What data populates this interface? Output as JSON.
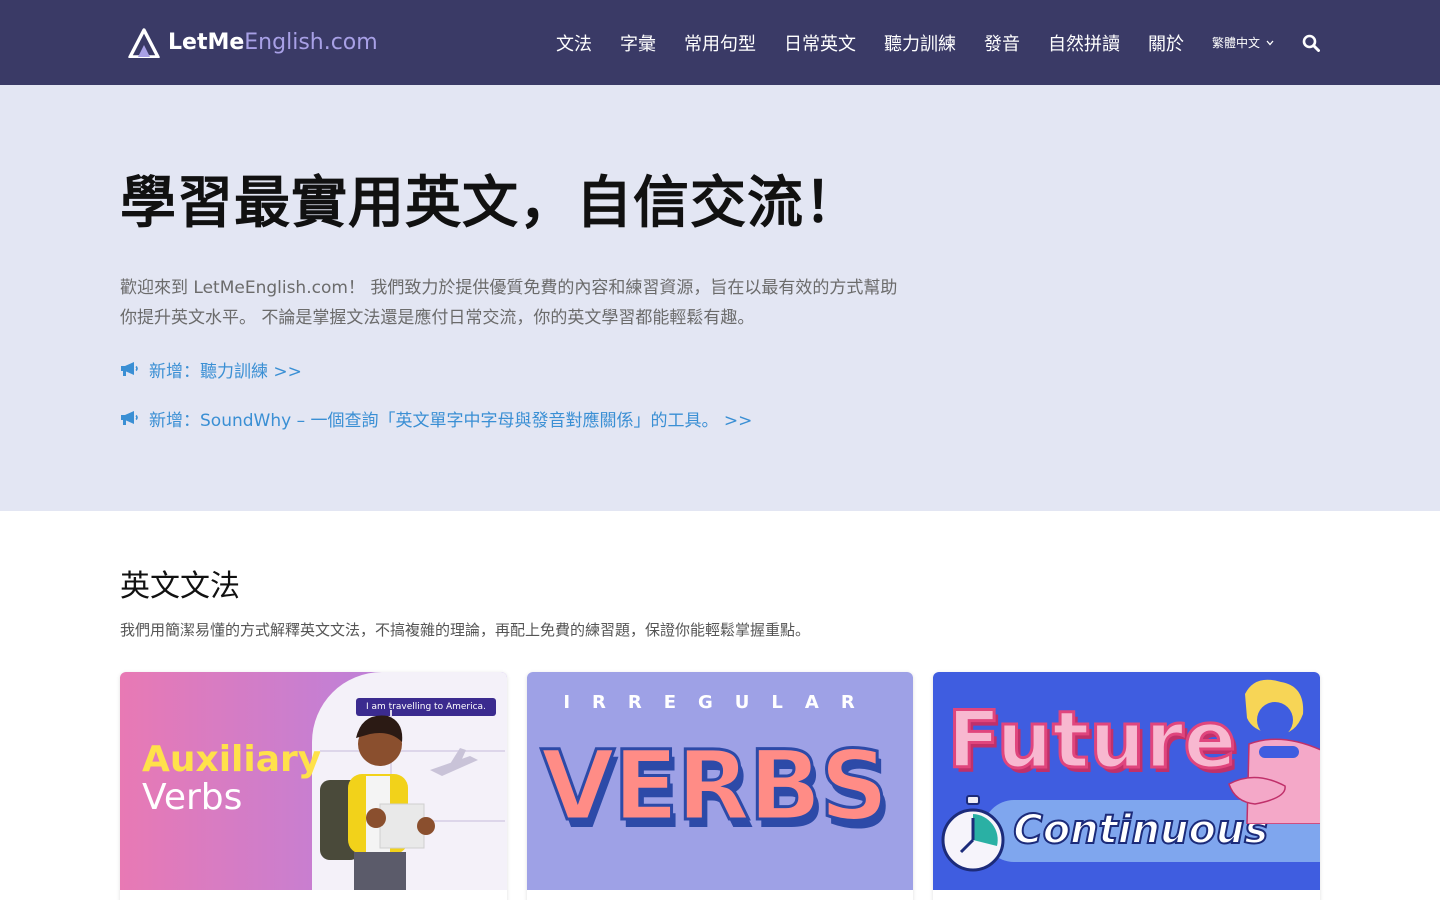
{
  "header": {
    "logo": {
      "part1": "LetMe",
      "part2": "English.com"
    },
    "nav": [
      {
        "label": "文法"
      },
      {
        "label": "字彙"
      },
      {
        "label": "常用句型"
      },
      {
        "label": "日常英文"
      },
      {
        "label": "聽力訓練"
      },
      {
        "label": "發音"
      },
      {
        "label": "自然拼讀"
      },
      {
        "label": "關於"
      }
    ],
    "language": "繁體中文",
    "icons": {
      "search": "search-icon",
      "language_caret": "chevron-down-icon"
    }
  },
  "hero": {
    "title": "學習最實用英文，自信交流！",
    "description": "歡迎來到 LetMeEnglish.com！ 我們致力於提供優質免費的內容和練習資源，旨在以最有效的方式幫助你提升英文水平。 不論是掌握文法還是應付日常交流，你的英文學習都能輕鬆有趣。",
    "announcements": [
      {
        "text": "新增：聽力訓練 >>",
        "icon": "megaphone-icon"
      },
      {
        "text": "新增：SoundWhy – 一個查詢「英文單字中字母與發音對應關係」的工具。 >>",
        "icon": "megaphone-icon"
      }
    ]
  },
  "grammar": {
    "title": "英文文法",
    "subtitle": "我們用簡潔易懂的方式解釋英文文法，不搞複雜的理論，再配上免費的練習題，保證你能輕鬆掌握重點。",
    "cards": [
      {
        "line1": "Auxiliary",
        "line2": "Verbs",
        "bubble": "I am travelling to America."
      },
      {
        "letters": "IRREGULAR",
        "word": "VERBS"
      },
      {
        "line1": "Future",
        "line2": "Continuous"
      }
    ]
  },
  "colors": {
    "nav_bg": "#3a3a66",
    "hero_bg": "#e3e6f3",
    "link": "#3a8fd4",
    "logo_accent": "#a8a0e6"
  }
}
